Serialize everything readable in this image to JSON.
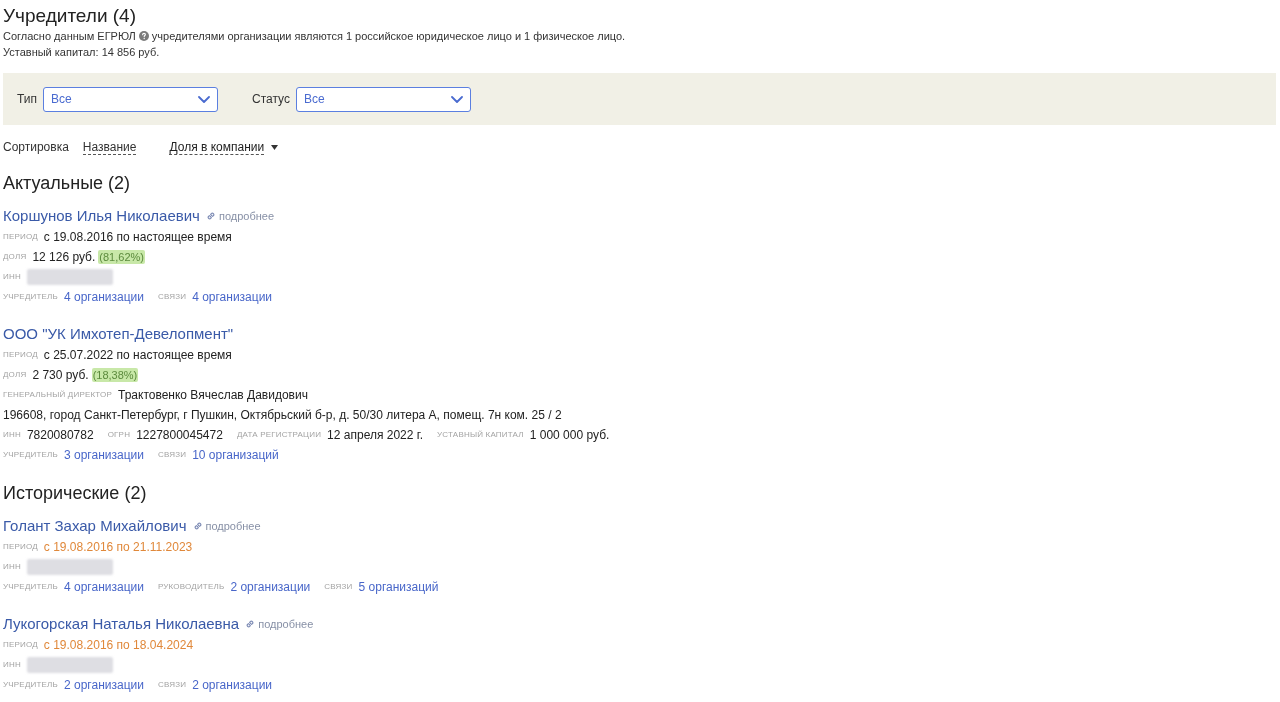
{
  "header": {
    "title": "Учредители (4)",
    "note_before": "Согласно данным ЕГРЮЛ",
    "note_after": "учредителями организации являются 1 российское юридическое лицо и 1 физическое лицо.",
    "capital": "Уставный капитал: 14 856 руб."
  },
  "filters": [
    {
      "label": "Тип",
      "value": "Все"
    },
    {
      "label": "Статус",
      "value": "Все"
    }
  ],
  "sort": {
    "label": "Сортировка",
    "options": [
      {
        "label": "Название",
        "selected": false
      },
      {
        "label": "Доля в компании",
        "selected": true
      }
    ]
  },
  "sections": [
    {
      "title": "Актуальные (2)",
      "founders": [
        {
          "name": "Коршунов Илья Николаевич",
          "more_link": "подробнее",
          "rows": [
            {
              "fields": [
                {
                  "kind": "period",
                  "label": "ПЕРИОД",
                  "value": "с 19.08.2016 по настоящее время",
                  "ended": false
                }
              ]
            },
            {
              "fields": [
                {
                  "kind": "share",
                  "label": "ДОЛЯ",
                  "value": "12 126 руб.",
                  "percent": "(81,62%)"
                }
              ]
            },
            {
              "fields": [
                {
                  "kind": "hidden",
                  "label": "ИНН"
                }
              ]
            },
            {
              "fields": [
                {
                  "kind": "link",
                  "label": "УЧРЕДИТЕЛЬ",
                  "value": "4 организации"
                },
                {
                  "kind": "link",
                  "label": "СВЯЗИ",
                  "value": "4 организации"
                }
              ]
            }
          ]
        },
        {
          "name": "ООО \"УК Имхотеп-Девелопмент\"",
          "rows": [
            {
              "fields": [
                {
                  "kind": "period",
                  "label": "ПЕРИОД",
                  "value": "с 25.07.2022 по настоящее время",
                  "ended": false
                }
              ]
            },
            {
              "fields": [
                {
                  "kind": "share",
                  "label": "ДОЛЯ",
                  "value": "2 730 руб.",
                  "percent": "(18,38%)"
                }
              ]
            },
            {
              "fields": [
                {
                  "kind": "text",
                  "label": "ГЕНЕРАЛЬНЫЙ ДИРЕКТОР",
                  "value": "Трактовенко Вячеслав Давидович"
                }
              ]
            },
            {
              "fields": [
                {
                  "kind": "address",
                  "value": "196608, город Санкт-Петербург, г Пушкин, Октябрьский б-р, д. 50/30 литера А, помещ. 7н ком. 25 / 2"
                }
              ]
            },
            {
              "fields": [
                {
                  "kind": "text",
                  "label": "ИНН",
                  "value": "7820080782"
                },
                {
                  "kind": "text",
                  "label": "ОГРН",
                  "value": "1227800045472"
                },
                {
                  "kind": "text",
                  "label": "ДАТА РЕГИСТРАЦИИ",
                  "value": "12 апреля 2022 г."
                },
                {
                  "kind": "text",
                  "label": "УСТАВНЫЙ КАПИТАЛ",
                  "value": "1 000 000 руб."
                }
              ]
            },
            {
              "fields": [
                {
                  "kind": "link",
                  "label": "УЧРЕДИТЕЛЬ",
                  "value": "3 организации"
                },
                {
                  "kind": "link",
                  "label": "СВЯЗИ",
                  "value": "10 организаций"
                }
              ]
            }
          ]
        }
      ]
    },
    {
      "title": "Исторические (2)",
      "founders": [
        {
          "name": "Голант Захар Михайлович",
          "more_link": "подробнее",
          "rows": [
            {
              "fields": [
                {
                  "kind": "period",
                  "label": "ПЕРИОД",
                  "value": "с 19.08.2016 по 21.11.2023",
                  "ended": true
                }
              ]
            },
            {
              "fields": [
                {
                  "kind": "hidden",
                  "label": "ИНН"
                }
              ]
            },
            {
              "fields": [
                {
                  "kind": "link",
                  "label": "УЧРЕДИТЕЛЬ",
                  "value": "4 организации"
                },
                {
                  "kind": "link",
                  "label": "РУКОВОДИТЕЛЬ",
                  "value": "2 организации"
                },
                {
                  "kind": "link",
                  "label": "СВЯЗИ",
                  "value": "5 организаций"
                }
              ]
            }
          ]
        },
        {
          "name": "Лукогорская Наталья Николаевна",
          "more_link": "подробнее",
          "rows": [
            {
              "fields": [
                {
                  "kind": "period",
                  "label": "ПЕРИОД",
                  "value": "с 19.08.2016 по 18.04.2024",
                  "ended": true
                }
              ]
            },
            {
              "fields": [
                {
                  "kind": "hidden",
                  "label": "ИНН"
                }
              ]
            },
            {
              "fields": [
                {
                  "kind": "link",
                  "label": "УЧРЕДИТЕЛЬ",
                  "value": "2 организации"
                },
                {
                  "kind": "link",
                  "label": "СВЯЗИ",
                  "value": "2 организации"
                }
              ]
            }
          ]
        }
      ]
    }
  ]
}
